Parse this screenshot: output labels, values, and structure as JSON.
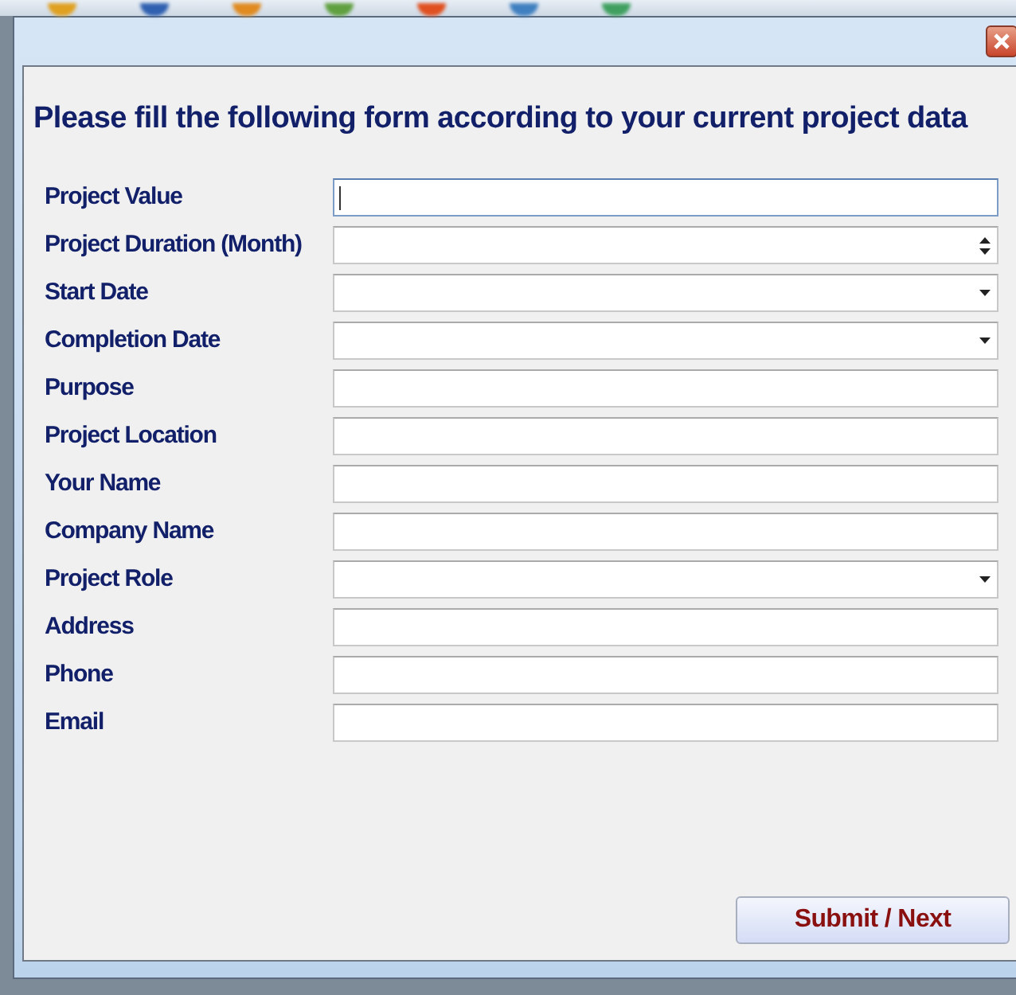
{
  "heading": "Please fill the following form according to your current project data",
  "fields": [
    {
      "label": "Project Value",
      "kind": "text",
      "focused": true
    },
    {
      "label": "Project Duration (Month)",
      "kind": "spin",
      "focused": false
    },
    {
      "label": "Start Date",
      "kind": "dropdown",
      "focused": false
    },
    {
      "label": "Completion Date",
      "kind": "dropdown",
      "focused": false
    },
    {
      "label": "Purpose",
      "kind": "text",
      "focused": false
    },
    {
      "label": "Project Location",
      "kind": "text",
      "focused": false
    },
    {
      "label": "Your Name",
      "kind": "text",
      "focused": false
    },
    {
      "label": "Company Name",
      "kind": "text",
      "focused": false
    },
    {
      "label": "Project Role",
      "kind": "dropdown",
      "focused": false
    },
    {
      "label": "Address",
      "kind": "text",
      "focused": false
    },
    {
      "label": "Phone",
      "kind": "text",
      "focused": false
    },
    {
      "label": "Email",
      "kind": "text",
      "focused": false
    }
  ],
  "submit_button": "Submit / Next"
}
